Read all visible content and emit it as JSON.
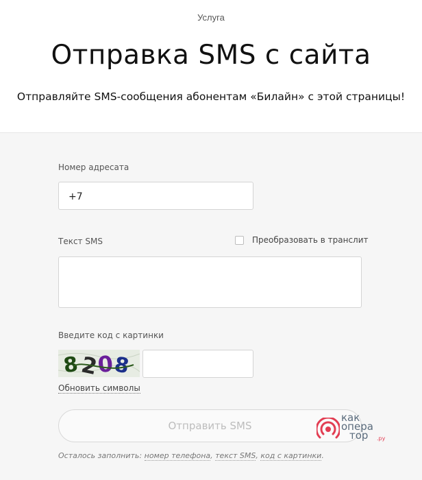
{
  "header": {
    "eyebrow": "Услуга",
    "title": "Отправка SMS с сайта",
    "subtitle": "Отправляйте SMS-сообщения абонентам «Билайн» с этой страницы!"
  },
  "form": {
    "recipient": {
      "label": "Номер адресата",
      "value": "+7"
    },
    "sms_text": {
      "label": "Текст SMS",
      "value": "",
      "translit_label": "Преобразовать в транслит",
      "translit_checked": false
    },
    "captcha": {
      "label": "Введите код с картинки",
      "image_text": "8208",
      "value": "",
      "refresh_label": "Обновить символы"
    },
    "submit_label": "Отправить SMS",
    "hint": {
      "prefix": "Осталось заполнить: ",
      "fields": [
        "номер телефона",
        "текст SMS",
        "код с картинки"
      ],
      "sep": ", ",
      "suffix": "."
    }
  },
  "watermark": {
    "lines": [
      "как",
      "опера",
      "тор"
    ],
    "tld": ".ру",
    "colors": {
      "accent": "#e23d52",
      "text": "#5a6b7c"
    }
  },
  "colors": {
    "page_bg": "#ffffff",
    "form_bg": "#f6f6f6",
    "input_border": "#d4d4d4",
    "button_text_disabled": "#bdbdbd"
  }
}
